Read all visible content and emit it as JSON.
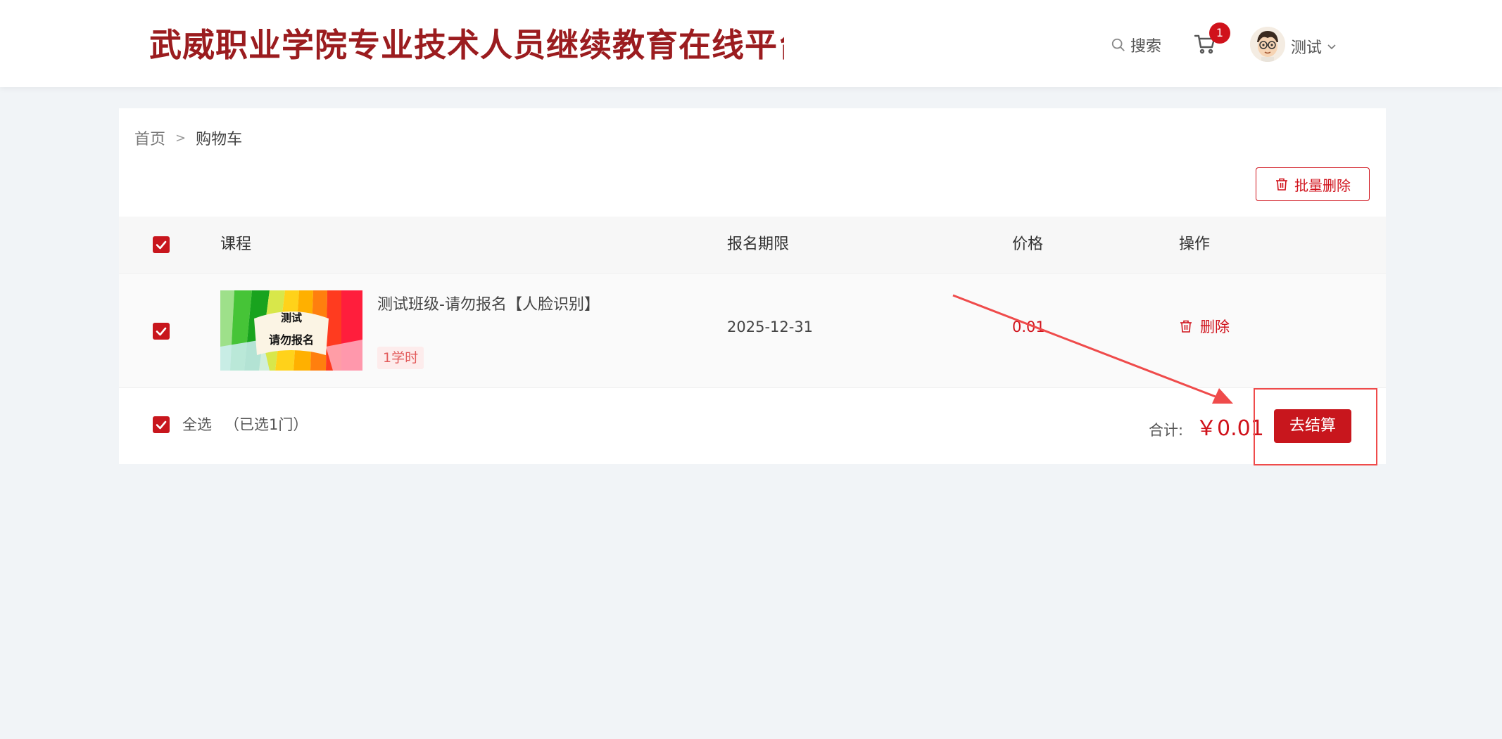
{
  "header": {
    "site_title": "武威职业学院专业技术人员继续教育在线平台",
    "search_label": "搜索",
    "cart_count": "1",
    "user_name": "测试"
  },
  "breadcrumb": {
    "home": "首页",
    "separator": ">",
    "current": "购物车"
  },
  "toolbar": {
    "batch_delete_label": "批量删除"
  },
  "table": {
    "headers": {
      "course": "课程",
      "deadline": "报名期限",
      "price": "价格",
      "action": "操作"
    },
    "rows": [
      {
        "checked": true,
        "course_name": "测试班级-请勿报名【人脸识别】",
        "hours": "1学时",
        "deadline": "2025-12-31",
        "price": "0.01",
        "delete_label": "删除",
        "thumb_text_line1": "测试",
        "thumb_text_line2": "请勿报名"
      }
    ]
  },
  "footer": {
    "select_all_label": "全选",
    "selected_count": "（已选1门）",
    "total_label": "合计:",
    "total_amount": "￥0.01",
    "checkout_label": "去结算"
  },
  "colors": {
    "brand_red": "#c8161d",
    "title_red": "#9b1c1f",
    "annotation_red": "#ef4b4b"
  }
}
